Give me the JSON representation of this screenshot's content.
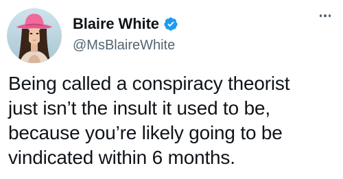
{
  "author": {
    "display_name": "Blaire White",
    "handle": "@MsBlaireWhite",
    "verified": true,
    "avatar_icon": "profile-photo-cowboy-hat"
  },
  "menu": {
    "more_icon": "more-options-icon"
  },
  "tweet": {
    "lines": [
      "Being called a conspiracy theorist",
      "just isn’t the insult it used to be,",
      "because you’re likely going to be",
      "vindicated within 6 months."
    ]
  },
  "colors": {
    "text": "#0f1419",
    "secondary_text": "#536471",
    "verified_badge": "#1d9bf0",
    "background": "#ffffff",
    "hat_pink": "#e8588e"
  }
}
